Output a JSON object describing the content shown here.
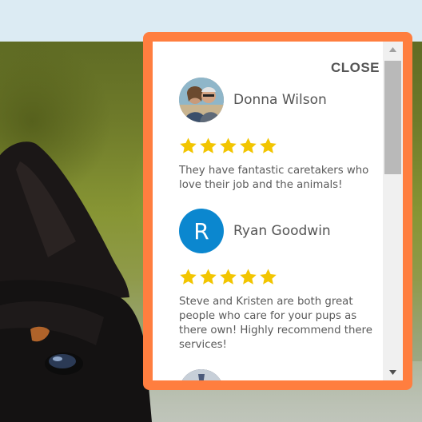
{
  "modal": {
    "close_label": "CLOSE",
    "border_color": "#ff7e3f",
    "reviews": [
      {
        "name": "Donna Wilson",
        "avatar": "photo",
        "stars": 5,
        "text": "They have fantastic caretakers who love their job and the animals!"
      },
      {
        "name": "Ryan Goodwin",
        "avatar_letter": "R",
        "avatar_color": "#0b87cf",
        "stars": 5,
        "text": "Steve and Kristen are both great people who care for your pups as there own! Highly recommend there services!"
      }
    ]
  },
  "icons": {
    "star": "star-icon",
    "scroll_up": "scroll-up-arrow-icon",
    "scroll_down": "scroll-down-arrow-icon"
  },
  "colors": {
    "star": "#f2c500",
    "accent": "#ff7e3f",
    "avatar_blue": "#0b87cf"
  }
}
